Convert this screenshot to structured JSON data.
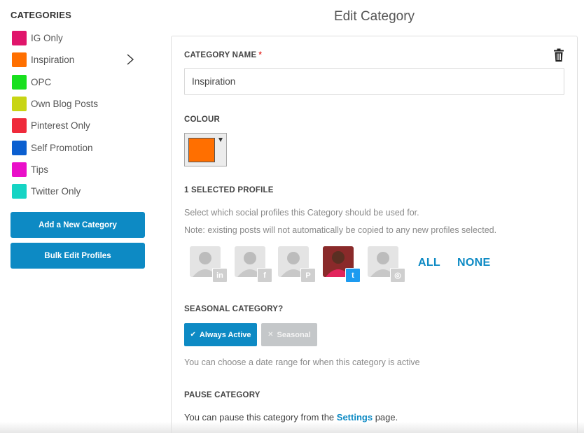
{
  "sidebar": {
    "title": "CATEGORIES",
    "categories": [
      {
        "label": "IG Only",
        "color": "#e0156b"
      },
      {
        "label": "Inspiration",
        "color": "#ff6f00"
      },
      {
        "label": "OPC",
        "color": "#18e01e"
      },
      {
        "label": "Own Blog Posts",
        "color": "#c8d514"
      },
      {
        "label": "Pinterest Only",
        "color": "#ef2a3b"
      },
      {
        "label": "Self Promotion",
        "color": "#0b5fd0"
      },
      {
        "label": "Tips",
        "color": "#ea0fc9"
      },
      {
        "label": "Twitter Only",
        "color": "#16d4c4"
      }
    ],
    "selected_index": 1,
    "add_button": "Add a New Category",
    "bulk_button": "Bulk Edit Profiles"
  },
  "page": {
    "title": "Edit Category"
  },
  "form": {
    "name_label": "CATEGORY NAME",
    "required_mark": "*",
    "name_value": "Inspiration",
    "colour_label": "COLOUR",
    "colour_value": "#ff6f00",
    "profiles_label": "1 SELECTED PROFILE",
    "profiles_help_1": "Select which social profiles this Category should be used for.",
    "profiles_help_2": "Note: existing posts will not automatically be copied to any new profiles selected.",
    "profiles": [
      {
        "network": "linkedin",
        "badge": "in",
        "selected": false
      },
      {
        "network": "facebook",
        "badge": "f",
        "selected": false
      },
      {
        "network": "pinterest",
        "badge": "P",
        "selected": false
      },
      {
        "network": "twitter",
        "badge": "t",
        "selected": true
      },
      {
        "network": "instagram",
        "badge": "◎",
        "selected": false
      }
    ],
    "all_label": "ALL",
    "none_label": "NONE",
    "seasonal_label": "SEASONAL CATEGORY?",
    "always_active_label": "Always Active",
    "seasonal_option_label": "Seasonal",
    "seasonal_help": "You can choose a date range for when this category is active",
    "pause_label": "PAUSE CATEGORY",
    "pause_text_before": "You can pause this category from the",
    "pause_link": "Settings",
    "pause_text_after": "page."
  },
  "colors": {
    "accent": "#0d8ac4",
    "required": "#e53935",
    "twitter": "#1d9bf0"
  }
}
